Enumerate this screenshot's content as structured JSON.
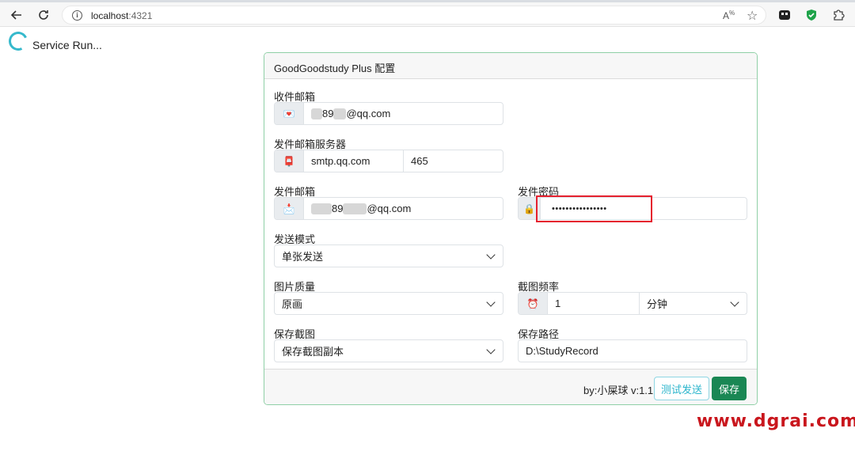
{
  "browser": {
    "url_host": "localhost",
    "url_port": ":4321",
    "reader_icon": "read-aloud-icon",
    "colors": {
      "accent": "#1a8754",
      "highlight": "#e5202e",
      "info": "#36b9cc"
    }
  },
  "page": {
    "status_text": "Service Run..."
  },
  "form": {
    "title": "GoodGoodstudy Plus 配置",
    "recv_email": {
      "label": "收件邮箱",
      "value_pre": "89",
      "value_post": "@qq.com"
    },
    "smtp": {
      "label": "发件邮箱服务器",
      "host": "smtp.qq.com",
      "port": "465"
    },
    "send_email": {
      "label": "发件邮箱",
      "value_pre": "89",
      "value_post": "@qq.com"
    },
    "password": {
      "label": "发件密码",
      "value": "••••••••••••••••"
    },
    "send_mode": {
      "label": "发送模式",
      "selected": "单张发送"
    },
    "quality": {
      "label": "图片质量",
      "selected": "原画"
    },
    "frequency": {
      "label": "截图频率",
      "value": "1",
      "unit": "分钟"
    },
    "save_shot": {
      "label": "保存截图",
      "selected": "保存截图副本"
    },
    "save_path": {
      "label": "保存路径",
      "value": "D:\\StudyRecord"
    },
    "footer": {
      "credit": "by:小屎球 v:1.1",
      "test_label": "测试发送",
      "save_label": "保存"
    }
  },
  "watermark": "www.dgrai.com"
}
